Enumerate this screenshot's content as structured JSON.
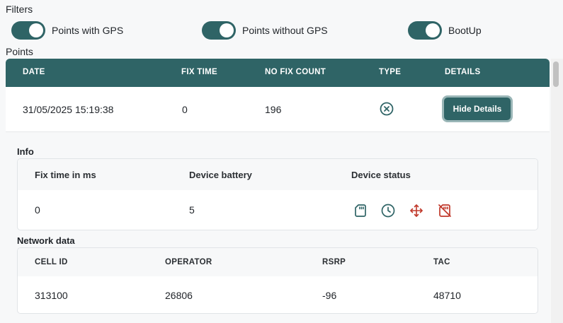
{
  "filters": {
    "label": "Filters",
    "toggles": [
      {
        "label": "Points with GPS",
        "on": true
      },
      {
        "label": "Points without GPS",
        "on": true
      },
      {
        "label": "BootUp",
        "on": true
      }
    ]
  },
  "points": {
    "label": "Points",
    "columns": [
      "DATE",
      "FIX TIME",
      "NO FIX COUNT",
      "TYPE",
      "DETAILS"
    ],
    "row": {
      "date": "31/05/2025 15:19:38",
      "fix_time": "0",
      "no_fix_count": "196",
      "type_icon": "circle-x-icon",
      "details_button": "Hide Details"
    }
  },
  "info": {
    "heading": "Info",
    "columns": [
      "Fix time in ms",
      "Device battery",
      "Device status"
    ],
    "values": {
      "fix_time_ms": "0",
      "battery": "5",
      "status_icons": [
        "sd-card-icon",
        "clock-icon",
        "move-arrows-icon",
        "sd-card-off-icon"
      ]
    }
  },
  "network": {
    "heading": "Network data",
    "columns": [
      "CELL ID",
      "OPERATOR",
      "RSRP",
      "TAC"
    ],
    "values": [
      "313100",
      "26806",
      "-96",
      "48710"
    ]
  },
  "colors": {
    "accent": "#2f6466",
    "status_ok": "#2f6466",
    "status_warn": "#c0392b"
  }
}
